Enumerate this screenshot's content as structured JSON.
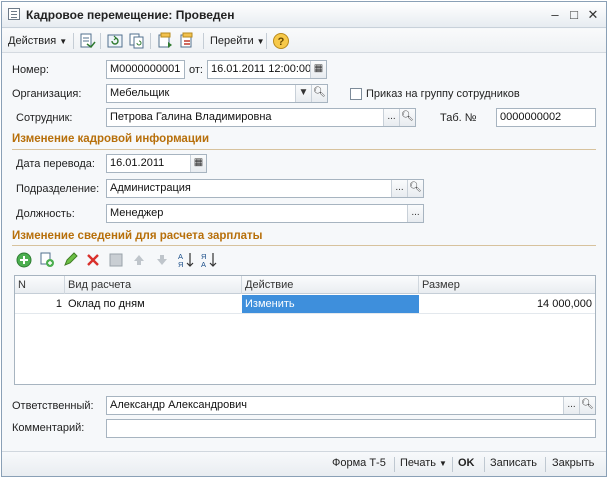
{
  "window": {
    "title": "Кадровое перемещение: Проведен"
  },
  "toolbar": {
    "actions_label": "Действия",
    "goto_label": "Перейти"
  },
  "header": {
    "number_label": "Номер:",
    "number_value": "М0000000001",
    "from_label": "от:",
    "date_value": "16.01.2011 12:00:00",
    "org_label": "Организация:",
    "org_value": "Мебельщик",
    "group_order_label": "Приказ на группу сотрудников",
    "employee_label": "Сотрудник:",
    "employee_value": "Петрова Галина Владимировна",
    "tab_label": "Таб. №",
    "tab_value": "0000000002"
  },
  "hr_section": {
    "title": "Изменение кадровой информации",
    "date_label": "Дата перевода:",
    "date_value": "16.01.2011",
    "dept_label": "Подразделение:",
    "dept_value": "Администрация",
    "position_label": "Должность:",
    "position_value": "Менеджер"
  },
  "salary_section": {
    "title": "Изменение сведений для расчета зарплаты",
    "columns": [
      "N",
      "Вид расчета",
      "Действие",
      "Размер"
    ],
    "rows": [
      {
        "n": "1",
        "kind": "Оклад по дням",
        "action": "Изменить",
        "amount": "14 000,000"
      }
    ]
  },
  "bottom": {
    "responsible_label": "Ответственный:",
    "responsible_value": "Александр Александрович",
    "comment_label": "Комментарий:",
    "comment_value": ""
  },
  "footer": {
    "form_t5": "Форма Т-5",
    "print_label": "Печать",
    "ok_label": "OK",
    "save_label": "Записать",
    "close_label": "Закрыть"
  },
  "colors": {
    "section_title": "#b76f0a",
    "selected_cell": "#3e8fdc"
  }
}
